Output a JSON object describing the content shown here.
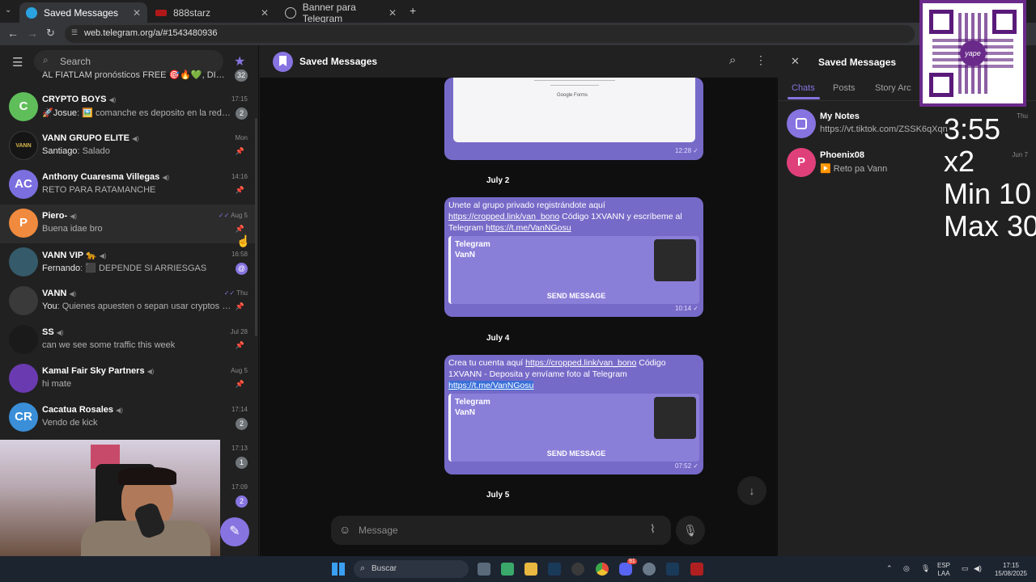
{
  "browser": {
    "tabs": [
      {
        "label": "Saved Messages",
        "active": true
      },
      {
        "label": "888starz",
        "active": false
      },
      {
        "label": "Banner para Telegram",
        "active": false
      }
    ],
    "url": "web.telegram.org/a/#1543480936"
  },
  "sidebar": {
    "search_placeholder": "Search",
    "truncated_top": "AL FIATLAM pronósticos FREE 🎯🔥💚, DIG DE...",
    "truncated_top_badge": "32",
    "chats": [
      {
        "name": "CRYPTO BOYS",
        "sender": "🚀Josue",
        "message": "🖼️ comanche es deposito en la red trc...",
        "time": "17:15",
        "badge": "2",
        "avatar_letter": "C",
        "avatar_color": "#5fbe5a"
      },
      {
        "name": "VANN GRUPO ELITE",
        "sender": "Santiago",
        "message": "Salado",
        "time": "Mon",
        "pinned": true,
        "avatar_color": "#151515"
      },
      {
        "name": "Anthony Cuaresma Villegas",
        "sender": "",
        "message": "RETO PARA RATAMANCHE",
        "time": "14:16",
        "pinned": true,
        "avatar_letter": "AC",
        "avatar_color": "#7b6fe0"
      },
      {
        "name": "Piero-",
        "sender": "",
        "message": "Buena idae bro",
        "time": "Aug 5",
        "pinned": true,
        "avatar_letter": "P",
        "avatar_color": "#f08a3e"
      },
      {
        "name": "VANN VIP 🐆",
        "sender": "Fernando",
        "message": "⬛ DEPENDE SI ARRIESGAS",
        "time": "16:58",
        "mention": "@",
        "avatar_color": "#355a6a"
      },
      {
        "name": "VANN",
        "sender": "You",
        "message": "Quienes apuesten o sepan usar cryptos co...",
        "time": "Thu",
        "pinned": true,
        "avatar_color": "#3a3a3a"
      },
      {
        "name": "SS",
        "sender": "",
        "message": "can we see some traffic this week",
        "time": "Jul 28",
        "pinned": true,
        "avatar_color": "#1a1a1a"
      },
      {
        "name": "Kamal Fair Sky Partners",
        "sender": "",
        "message": "hi mate",
        "time": "Aug 5",
        "pinned": true,
        "avatar_color": "#6a3ab0"
      },
      {
        "name": "Cacatua Rosales",
        "sender": "",
        "message": "Vendo de kick",
        "time": "17:14",
        "badge": "2",
        "avatar_letter": "CR",
        "avatar_color": "#3a8fd8"
      }
    ],
    "hidden_rows": [
      {
        "time": "17:13",
        "badge": "1"
      },
      {
        "time": "17:09",
        "badge": "2"
      }
    ]
  },
  "chat": {
    "title": "Saved Messages",
    "top_form_text": "Google Forms",
    "top_time": "12:28",
    "messages": [
      {
        "date": "July 2",
        "text_pre": "Unete al grupo privado registrándote aquí ",
        "link1": "https://cropped.link/van_bono",
        "text_mid": " Código 1XVANN y escríbeme al Telegram ",
        "link2": "https://t.me/VanNGosu",
        "preview_site": "Telegram",
        "preview_title": "VanN",
        "button": "SEND MESSAGE",
        "time": "10:14"
      },
      {
        "date": "July 4",
        "text_pre": "Crea tu cuenta aquí ",
        "link1": "https://cropped.link/van_bono",
        "text_mid": " Código 1XVANN - Deposita y envíame foto al Telegram ",
        "link2": "https://t.me/VanNGosu",
        "preview_site": "Telegram",
        "preview_title": "VanN",
        "button": "SEND MESSAGE",
        "time": "07:52"
      }
    ],
    "next_date": "July 5",
    "composer_placeholder": "Message"
  },
  "right_panel": {
    "title": "Saved Messages",
    "tabs": [
      "Chats",
      "Posts",
      "Story Arc"
    ],
    "items": [
      {
        "name": "My Notes",
        "sub": "https://vt.tiktok.com/ZSSK6qXqn",
        "time": "Thu"
      },
      {
        "name": "Phoenix08",
        "sub": "▶️ Reto pa Vann",
        "time": "Jun 7",
        "avatar_letter": "P"
      }
    ]
  },
  "overlay": {
    "qr_brand": "yape",
    "lines": [
      "3:55",
      "x2",
      "Min 10",
      "Max 30"
    ]
  },
  "taskbar": {
    "search": "Buscar",
    "lang": "ESP",
    "lang2": "LAA",
    "time": "17:15",
    "date": "15/08/2025",
    "discord_badge": "91"
  }
}
